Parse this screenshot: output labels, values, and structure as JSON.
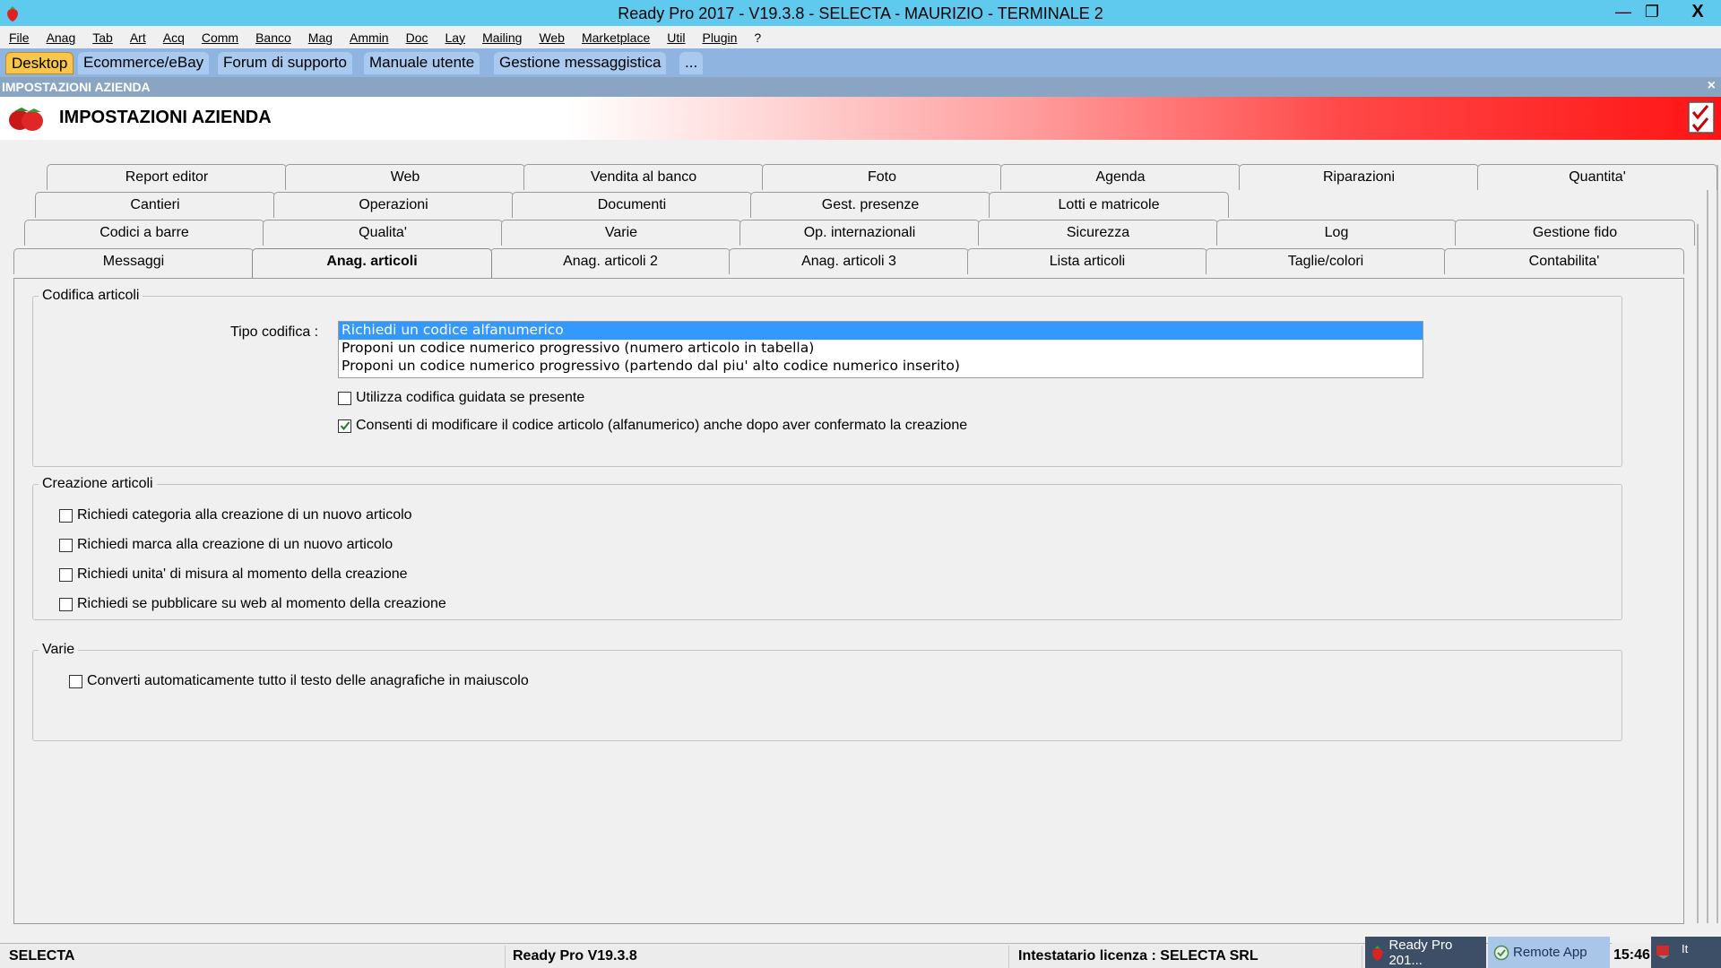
{
  "window": {
    "title": "Ready Pro 2017 - V19.3.8 - SELECTA - MAURIZIO - TERMINALE 2",
    "minimize": "—",
    "maximize": "❐",
    "close": "X"
  },
  "menu": [
    "File",
    "Anag",
    "Tab",
    "Art",
    "Acq",
    "Comm",
    "Banco",
    "Mag",
    "Ammin",
    "Doc",
    "Lay",
    "Mailing",
    "Web",
    "Marketplace",
    "Util",
    "Plugin",
    "?"
  ],
  "shortcut_tabs": [
    "Desktop",
    "Ecommerce/eBay",
    "Forum di supporto",
    "Manuale utente",
    "Gestione messaggistica",
    "..."
  ],
  "subwindow": {
    "label": "IMPOSTAZIONI AZIENDA",
    "close": "×"
  },
  "header": {
    "title": "IMPOSTAZIONI AZIENDA"
  },
  "tabs": {
    "row1": [
      "Report editor",
      "Web",
      "Vendita al banco",
      "Foto",
      "Agenda",
      "Riparazioni",
      "Quantita'"
    ],
    "row2": [
      "Cantieri",
      "Operazioni",
      "Documenti",
      "Gest. presenze",
      "Lotti e matricole"
    ],
    "row3": [
      "Codici a barre",
      "Qualita'",
      "Varie",
      "Op. internazionali",
      "Sicurezza",
      "Log",
      "Gestione fido"
    ],
    "row4": [
      "Messaggi",
      "Anag. articoli",
      "Anag. articoli 2",
      "Anag. articoli 3",
      "Lista articoli",
      "Taglie/colori",
      "Contabilita'"
    ],
    "active": "Anag. articoli"
  },
  "codifica": {
    "legend": "Codifica articoli",
    "tipo_label": "Tipo codifica :",
    "options": [
      "Richiedi un codice alfanumerico",
      "Proponi un codice numerico progressivo (numero articolo in tabella)",
      "Proponi un codice numerico progressivo (partendo dal piu' alto codice numerico inserito)"
    ],
    "selected_index": 0,
    "cb_guidata": {
      "label": "Utilizza codifica guidata se presente",
      "checked": false
    },
    "cb_modifica": {
      "label": "Consenti di modificare il codice articolo (alfanumerico) anche dopo aver confermato la creazione",
      "checked": true
    }
  },
  "creazione": {
    "legend": "Creazione articoli",
    "items": [
      {
        "label": "Richiedi categoria alla creazione di un nuovo articolo",
        "checked": false
      },
      {
        "label": "Richiedi marca alla creazione di un nuovo articolo",
        "checked": false
      },
      {
        "label": "Richiedi unita' di misura al momento della creazione",
        "checked": false
      },
      {
        "label": "Richiedi se pubblicare su web al momento della creazione",
        "checked": false
      }
    ]
  },
  "varie": {
    "legend": "Varie",
    "cb_maiuscolo": {
      "label": "Converti automaticamente tutto il testo delle anagrafiche in maiuscolo",
      "checked": false
    }
  },
  "status": {
    "company": "SELECTA",
    "version": "Ready Pro V19.3.8",
    "license": "Intestatario licenza : SELECTA SRL",
    "task_readypro": "Ready Pro 201...",
    "task_remote": "Remote App",
    "time": "15:46",
    "tray": "It"
  },
  "colors": {
    "titlebar": "#5fc9ee",
    "shortcut_active": "#f7c64b",
    "selection": "#3399ff",
    "header_red": "#ff1414"
  }
}
